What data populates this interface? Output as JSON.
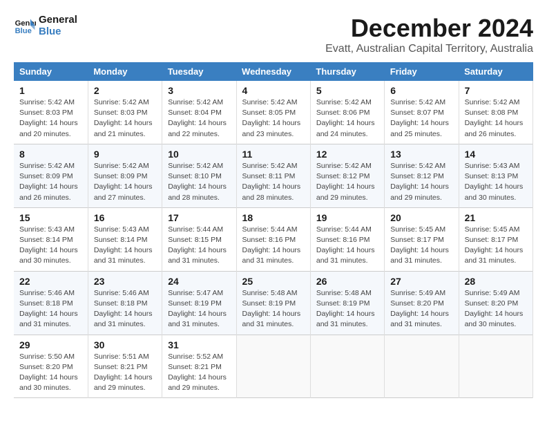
{
  "logo": {
    "line1": "General",
    "line2": "Blue"
  },
  "title": "December 2024",
  "location": "Evatt, Australian Capital Territory, Australia",
  "days_of_week": [
    "Sunday",
    "Monday",
    "Tuesday",
    "Wednesday",
    "Thursday",
    "Friday",
    "Saturday"
  ],
  "weeks": [
    [
      {
        "day": "1",
        "sunrise": "5:42 AM",
        "sunset": "8:03 PM",
        "daylight": "14 hours and 20 minutes."
      },
      {
        "day": "2",
        "sunrise": "5:42 AM",
        "sunset": "8:03 PM",
        "daylight": "14 hours and 21 minutes."
      },
      {
        "day": "3",
        "sunrise": "5:42 AM",
        "sunset": "8:04 PM",
        "daylight": "14 hours and 22 minutes."
      },
      {
        "day": "4",
        "sunrise": "5:42 AM",
        "sunset": "8:05 PM",
        "daylight": "14 hours and 23 minutes."
      },
      {
        "day": "5",
        "sunrise": "5:42 AM",
        "sunset": "8:06 PM",
        "daylight": "14 hours and 24 minutes."
      },
      {
        "day": "6",
        "sunrise": "5:42 AM",
        "sunset": "8:07 PM",
        "daylight": "14 hours and 25 minutes."
      },
      {
        "day": "7",
        "sunrise": "5:42 AM",
        "sunset": "8:08 PM",
        "daylight": "14 hours and 26 minutes."
      }
    ],
    [
      {
        "day": "8",
        "sunrise": "5:42 AM",
        "sunset": "8:09 PM",
        "daylight": "14 hours and 26 minutes."
      },
      {
        "day": "9",
        "sunrise": "5:42 AM",
        "sunset": "8:09 PM",
        "daylight": "14 hours and 27 minutes."
      },
      {
        "day": "10",
        "sunrise": "5:42 AM",
        "sunset": "8:10 PM",
        "daylight": "14 hours and 28 minutes."
      },
      {
        "day": "11",
        "sunrise": "5:42 AM",
        "sunset": "8:11 PM",
        "daylight": "14 hours and 28 minutes."
      },
      {
        "day": "12",
        "sunrise": "5:42 AM",
        "sunset": "8:12 PM",
        "daylight": "14 hours and 29 minutes."
      },
      {
        "day": "13",
        "sunrise": "5:42 AM",
        "sunset": "8:12 PM",
        "daylight": "14 hours and 29 minutes."
      },
      {
        "day": "14",
        "sunrise": "5:43 AM",
        "sunset": "8:13 PM",
        "daylight": "14 hours and 30 minutes."
      }
    ],
    [
      {
        "day": "15",
        "sunrise": "5:43 AM",
        "sunset": "8:14 PM",
        "daylight": "14 hours and 30 minutes."
      },
      {
        "day": "16",
        "sunrise": "5:43 AM",
        "sunset": "8:14 PM",
        "daylight": "14 hours and 31 minutes."
      },
      {
        "day": "17",
        "sunrise": "5:44 AM",
        "sunset": "8:15 PM",
        "daylight": "14 hours and 31 minutes."
      },
      {
        "day": "18",
        "sunrise": "5:44 AM",
        "sunset": "8:16 PM",
        "daylight": "14 hours and 31 minutes."
      },
      {
        "day": "19",
        "sunrise": "5:44 AM",
        "sunset": "8:16 PM",
        "daylight": "14 hours and 31 minutes."
      },
      {
        "day": "20",
        "sunrise": "5:45 AM",
        "sunset": "8:17 PM",
        "daylight": "14 hours and 31 minutes."
      },
      {
        "day": "21",
        "sunrise": "5:45 AM",
        "sunset": "8:17 PM",
        "daylight": "14 hours and 31 minutes."
      }
    ],
    [
      {
        "day": "22",
        "sunrise": "5:46 AM",
        "sunset": "8:18 PM",
        "daylight": "14 hours and 31 minutes."
      },
      {
        "day": "23",
        "sunrise": "5:46 AM",
        "sunset": "8:18 PM",
        "daylight": "14 hours and 31 minutes."
      },
      {
        "day": "24",
        "sunrise": "5:47 AM",
        "sunset": "8:19 PM",
        "daylight": "14 hours and 31 minutes."
      },
      {
        "day": "25",
        "sunrise": "5:48 AM",
        "sunset": "8:19 PM",
        "daylight": "14 hours and 31 minutes."
      },
      {
        "day": "26",
        "sunrise": "5:48 AM",
        "sunset": "8:19 PM",
        "daylight": "14 hours and 31 minutes."
      },
      {
        "day": "27",
        "sunrise": "5:49 AM",
        "sunset": "8:20 PM",
        "daylight": "14 hours and 31 minutes."
      },
      {
        "day": "28",
        "sunrise": "5:49 AM",
        "sunset": "8:20 PM",
        "daylight": "14 hours and 30 minutes."
      }
    ],
    [
      {
        "day": "29",
        "sunrise": "5:50 AM",
        "sunset": "8:20 PM",
        "daylight": "14 hours and 30 minutes."
      },
      {
        "day": "30",
        "sunrise": "5:51 AM",
        "sunset": "8:21 PM",
        "daylight": "14 hours and 29 minutes."
      },
      {
        "day": "31",
        "sunrise": "5:52 AM",
        "sunset": "8:21 PM",
        "daylight": "14 hours and 29 minutes."
      },
      null,
      null,
      null,
      null
    ]
  ],
  "labels": {
    "sunrise": "Sunrise:",
    "sunset": "Sunset:",
    "daylight": "Daylight:"
  }
}
